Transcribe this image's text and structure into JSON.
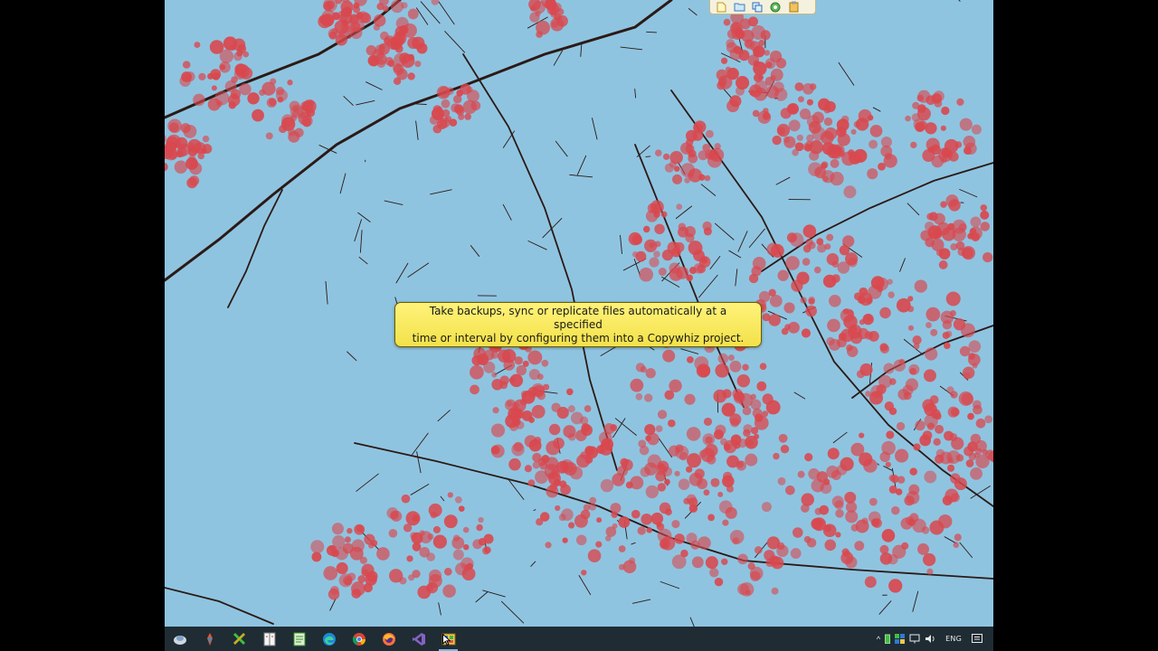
{
  "tooltip": {
    "line1": "Take backups, sync or replicate files automatically at a specified",
    "line2": "time or interval by configuring them into a Copywhiz project."
  },
  "colors": {
    "sky": "#8fc4e0",
    "blossom": "#d9484e",
    "branch": "#2b1a16",
    "tooltip_fill": "#f7e65a",
    "taskbar": "#1f2c34"
  },
  "mini_toolbar": {
    "icons": [
      "new-file-icon",
      "open-folder-icon",
      "copy-icon",
      "refresh-icon",
      "clipboard-icon"
    ]
  },
  "taskbar": {
    "apps": [
      "start-icon",
      "paint-3d-icon",
      "copywhiz-x-icon",
      "notebook-icon",
      "notepad-icon",
      "edge-icon",
      "chrome-icon",
      "firefox-icon",
      "visual-studio-icon",
      "copywhiz-icon"
    ],
    "active_app": "copywhiz-icon"
  },
  "tray": {
    "chevron": "^",
    "language": "ENG"
  }
}
